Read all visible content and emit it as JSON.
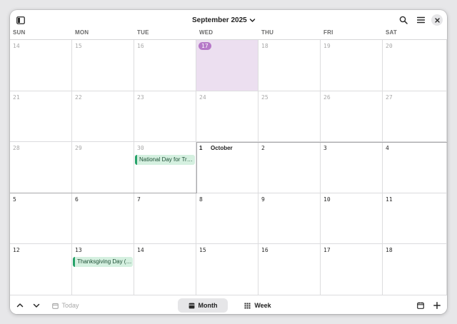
{
  "header": {
    "title": "September 2025",
    "icons": [
      "sidebar-toggle-icon",
      "chevron-down-icon",
      "search-icon",
      "hamburger-menu-icon",
      "close-icon"
    ]
  },
  "weekdays": [
    "SUN",
    "MON",
    "TUE",
    "WED",
    "THU",
    "FRI",
    "SAT"
  ],
  "weeks": [
    [
      "14",
      "15",
      "16",
      "17",
      "18",
      "19",
      "20"
    ],
    [
      "21",
      "22",
      "23",
      "24",
      "25",
      "26",
      "27"
    ],
    [
      "28",
      "29",
      "30",
      "1",
      "2",
      "3",
      "4"
    ],
    [
      "5",
      "6",
      "7",
      "8",
      "9",
      "10",
      "11"
    ],
    [
      "12",
      "13",
      "14",
      "15",
      "16",
      "17",
      "18"
    ]
  ],
  "month_marker": {
    "label": "October"
  },
  "today": "17",
  "events": [
    {
      "title": "National Day for Tr…"
    },
    {
      "title": "Thanksgiving Day (…"
    }
  ],
  "footer": {
    "today_label": "Today",
    "month_label": "Month",
    "week_label": "Week"
  },
  "colors": {
    "today_bg": "#ecdff0",
    "today_accent": "#b678c8",
    "event_accent": "#26a269",
    "event_bg": "#d5f0e0"
  }
}
